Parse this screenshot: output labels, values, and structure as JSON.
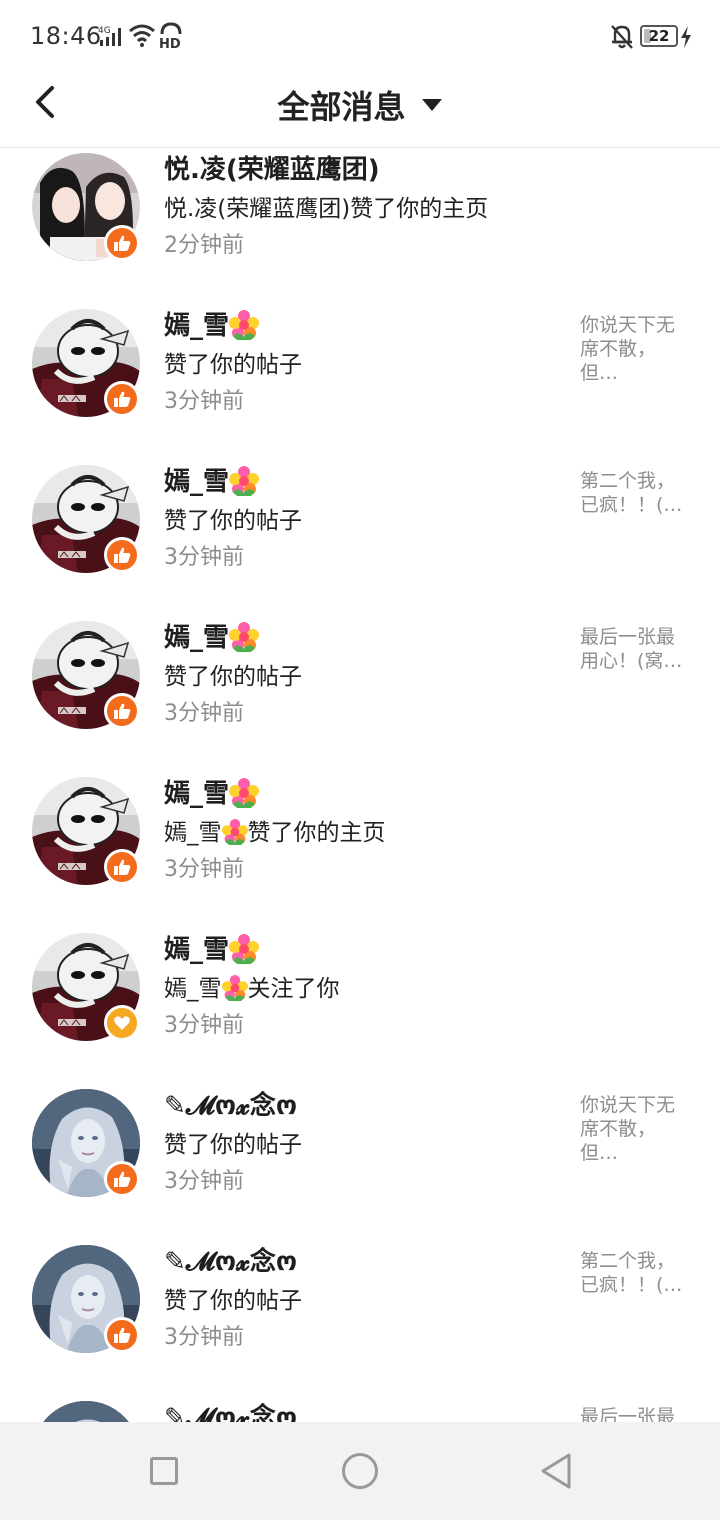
{
  "status_bar": {
    "time": "18:46",
    "network": "4G",
    "hd_label": "HD",
    "battery": "22",
    "battery_fraction": 0.22
  },
  "header": {
    "title": "全部消息"
  },
  "notifications": [
    {
      "name": "悦.凌(荣耀蓝鹰团)",
      "name_flower": false,
      "message_prefix": "悦.凌(荣耀蓝鹰团)赞了你的主页",
      "message_flower": false,
      "message_suffix": "",
      "time": "2分钟前",
      "preview": "",
      "badge": "like",
      "avatar": "girls-photo"
    },
    {
      "name": "嫣_雪",
      "name_flower": true,
      "message_prefix": "赞了你的帖子",
      "message_flower": false,
      "message_suffix": "",
      "time": "3分钟前",
      "preview": "你说天下无席不散，但…",
      "badge": "like",
      "avatar": "mask-figure"
    },
    {
      "name": "嫣_雪",
      "name_flower": true,
      "message_prefix": "赞了你的帖子",
      "message_flower": false,
      "message_suffix": "",
      "time": "3分钟前",
      "preview": "第二个我，已疯！！(…",
      "badge": "like",
      "avatar": "mask-figure"
    },
    {
      "name": "嫣_雪",
      "name_flower": true,
      "message_prefix": "赞了你的帖子",
      "message_flower": false,
      "message_suffix": "",
      "time": "3分钟前",
      "preview": "最后一张最用心！(窝…",
      "badge": "like",
      "avatar": "mask-figure"
    },
    {
      "name": "嫣_雪",
      "name_flower": true,
      "message_prefix": "嫣_雪",
      "message_flower": true,
      "message_suffix": "赞了你的主页",
      "time": "3分钟前",
      "preview": "",
      "badge": "like",
      "avatar": "mask-figure"
    },
    {
      "name": "嫣_雪",
      "name_flower": true,
      "message_prefix": "嫣_雪",
      "message_flower": true,
      "message_suffix": "关注了你",
      "time": "3分钟前",
      "preview": "",
      "badge": "follow",
      "avatar": "mask-figure"
    },
    {
      "name": "✎𝓜ო𝔁念ო",
      "name_flower": false,
      "message_prefix": "赞了你的帖子",
      "message_flower": false,
      "message_suffix": "",
      "time": "3分钟前",
      "preview": "你说天下无席不散，但…",
      "badge": "like",
      "avatar": "silver-girl"
    },
    {
      "name": "✎𝓜ო𝔁念ო",
      "name_flower": false,
      "message_prefix": "赞了你的帖子",
      "message_flower": false,
      "message_suffix": "",
      "time": "3分钟前",
      "preview": "第二个我，已疯！！(…",
      "badge": "like",
      "avatar": "silver-girl"
    },
    {
      "name": "✎𝓜ო𝔁念ო",
      "name_flower": false,
      "message_prefix": "",
      "message_flower": false,
      "message_suffix": "",
      "time": "",
      "preview": "最后一张最",
      "badge": "like",
      "avatar": "silver-girl"
    }
  ],
  "colors": {
    "like_badge": "#f36b1c",
    "follow_badge": "#f7a823",
    "secondary_text": "#8d8d8d",
    "nav_bar": "#f2f2f2"
  },
  "icons": {
    "back": "chevron-left-icon",
    "dropdown": "caret-down-icon",
    "like": "thumb-up-icon",
    "follow": "heart-icon",
    "nav_recent": "square-icon",
    "nav_home": "circle-icon",
    "nav_back": "triangle-back-icon"
  }
}
